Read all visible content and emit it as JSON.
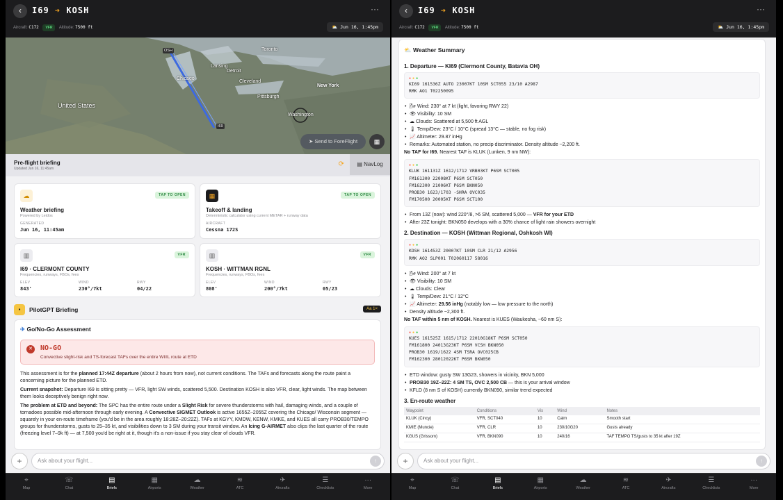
{
  "route": {
    "from": "I69",
    "to": "KOSH",
    "arrow": "➔"
  },
  "header": {
    "back_icon": "‹",
    "more_icon": "···",
    "aircraft_label": "Aircraft:",
    "aircraft": "C172",
    "rules_badge": "VFR",
    "altitude_label": "Altitude:",
    "altitude": "7500 ft",
    "time_icon": "⛅",
    "departure_time": "Jun 16, 1:45pm"
  },
  "map": {
    "labels": [
      "Toronto",
      "Lansing",
      "Detroit",
      "Chicago",
      "Cleveland",
      "New York",
      "United States",
      "Pittsburgh",
      "Washington",
      "I69",
      "OSH"
    ],
    "send_button": "Send to ForeFlight",
    "send_icon": "➤",
    "toggle_icon": "▦"
  },
  "preflight": {
    "title": "Pre-flight briefing",
    "updated": "Updated Jun 16, 11:45am",
    "refresh_icon": "⟳",
    "navlog_icon": "▤",
    "navlog_label": "NavLog"
  },
  "cards": {
    "tap_label": "TAP TO OPEN",
    "weather": {
      "title": "Weather briefing",
      "subtitle": "Powered by Leidos",
      "meta_label": "GENERATED",
      "meta_value": "Jun 16, 11:45am"
    },
    "takeoff": {
      "title": "Takeoff & landing",
      "subtitle": "Deterministic calculator using current METAR + runway data",
      "meta_label": "AIRCRAFT",
      "meta_value": "Cessna 172S"
    },
    "airport_labels": {
      "elev": "ELEV",
      "wind": "WIND",
      "rwy": "RWY"
    },
    "dep": {
      "title": "I69 · CLERMONT COUNTY",
      "subtitle": "Frequencies, runways, FBOs, fees",
      "badge": "VFR",
      "elev": "843'",
      "wind": "230°/7kt",
      "rwy": "04/22"
    },
    "arr": {
      "title": "KOSH · WITTMAN RGNL",
      "subtitle": "Frequencies, runways, FBOs, fees",
      "badge": "VFR",
      "elev": "808'",
      "wind": "200°/7kt",
      "rwy": "05/23"
    }
  },
  "pilotgpt": {
    "title": "PilotGPT Briefing",
    "font_chip": "Aa 1×"
  },
  "assessment": {
    "icon": "✈",
    "title": "Go/No-Go Assessment",
    "verdict_icon": "✕",
    "verdict": "NO-GO",
    "verdict_sub": "Convective slight-risk and TS-forecast TAFs over the entire WI/IL route at ETD",
    "p1a": "This assessment is for the ",
    "p1b": "planned 17:44Z departure",
    "p1c": " (about 2 hours from now), not current conditions. The TAFs and forecasts along the route paint a concerning picture for the planned ETD.",
    "p2a": "Current snapshot:",
    "p2b": " Departure I69 is sitting pretty — VFR, light SW winds, scattered 5,500. Destination KOSH is also VFR, clear, light winds. The map between them looks deceptively benign right now.",
    "p3a": "The problem at ETD and beyond:",
    "p3b": " The SPC has the entire route under a ",
    "p3c": "Slight Risk",
    "p3d": " for severe thunderstorms with hail, damaging winds, and a couple of tornadoes possible mid-afternoon through early evening. A ",
    "p3e": "Convective SIGMET Outlook",
    "p3f": " is active 1655Z–2055Z covering the Chicago/ Wisconsin segment — squarely in your en-route timeframe (you'd be in the area roughly 18:28Z–20:22Z). TAFs at KGYY, KMDW, KENW, KMKE, and KUES all carry PROB30/TEMPO groups for thunderstorms, gusts to 25–35 kt, and visibilities down to 3 SM during your transit window. An ",
    "p3g": "Icing G-AIRMET",
    "p3h": " also clips the last quarter of the route (freezing level 7–9k ft) — at 7,500 you'd be right at it, though it's a non-issue if you stay clear of clouds VFR."
  },
  "chat": {
    "plus_icon": "+",
    "placeholder": "Ask about your flight...",
    "send_icon": "↑"
  },
  "tabs": [
    {
      "icon": "⌖",
      "label": "Map"
    },
    {
      "icon": "☏",
      "label": "Chat"
    },
    {
      "icon": "▤",
      "label": "Briefs"
    },
    {
      "icon": "▦",
      "label": "Airports"
    },
    {
      "icon": "☁",
      "label": "Weather"
    },
    {
      "icon": "≋",
      "label": "ATC"
    },
    {
      "icon": "✈",
      "label": "Aircrafts"
    },
    {
      "icon": "☰",
      "label": "Checklists"
    },
    {
      "icon": "···",
      "label": "More"
    }
  ],
  "active_tab": "Briefs",
  "weather": {
    "icon": "⛅",
    "title": "Weather Summary",
    "dep_heading": "1. Departure — KI69 (Clermont County, Batavia OH)",
    "dep_metar": "KI69 161536Z AUTO 23007KT 10SM SCT055 23/10 A2987\nRMK AO1 T02250095",
    "dep_items": [
      {
        "icon": "🌬",
        "text": "Wind: 230° at 7 kt (light, favoring RWY 22)"
      },
      {
        "icon": "👁",
        "text": "Visibility: 10 SM"
      },
      {
        "icon": "☁",
        "text": "Clouds: Scattered at 5,500 ft AGL"
      },
      {
        "icon": "🌡",
        "text": "Temp/Dew: 23°C / 10°C (spread 13°C — stable, no fog risk)"
      },
      {
        "icon": "📈",
        "text": "Altimeter: 29.87 inHg"
      },
      {
        "icon": "",
        "text": "Remarks: Automated station, no precip discriminator. Density altitude ~2,200 ft."
      }
    ],
    "dep_taf_note_b": "No TAF for I69.",
    "dep_taf_note": " Nearest TAF is KLUK (Lunken, 9 nm NW):",
    "dep_taf": "KLUK 161131Z 1612/1712 VRB03KT P6SM SCT005\nFM161300 22008KT P6SM SCT050\nFM162300 21006KT P6SM BKN050\nPROB30 1623/1703 -SHRA OVC035\nFM170500 20005KT P6SM SCT100",
    "dep_taf_i1a": "From 13Z (now): wind 220°/8, >6 SM, scattered 5,000 — ",
    "dep_taf_i1b": "VFR for your ETD",
    "dep_taf_i2": "After 23Z tonight: BKN050 develops with a 30% chance of light rain showers overnight",
    "arr_heading": "2. Destination — KOSH (Wittman Regional, Oshkosh WI)",
    "arr_metar": "KOSH 161453Z 20007KT 10SM CLR 21/12 A2956\nRMK AO2 SLP001 T02060117 58016",
    "arr_items": [
      {
        "icon": "🌬",
        "text": "Wind: 200° at 7 kt"
      },
      {
        "icon": "👁",
        "text": "Visibility: 10 SM"
      },
      {
        "icon": "☁",
        "text": "Clouds: Clear"
      },
      {
        "icon": "🌡",
        "text": "Temp/Dew: 21°C / 12°C"
      }
    ],
    "arr_alt_a": "Altimeter: ",
    "arr_alt_b": "29.56 inHg",
    "arr_alt_c": " (notably low — low pressure to the north)",
    "arr_density": "Density altitude ~2,300 ft.",
    "arr_taf_note_b": "No TAF within 5 nm of KOSH.",
    "arr_taf_note": " Nearest is KUES (Waukesha, ~60 nm S):",
    "arr_taf": "KUES 161525Z 1615/1712 22010G18KT P6SM SCT050\nFM161800 24013G23KT P6SM VCSH BKN050\nPROB30 1619/1622 4SM TSRA OVC025CB\nFM162300 28012022KT P6SM BKN050",
    "arr_i1": "ETD window: gusty SW 13G23, showers in vicinity, BKN 5,000",
    "arr_i2a": "PROB30 19Z–22Z: 4 SM TS, OVC 2,500 CB",
    "arr_i2b": " — this is your arrival window",
    "arr_i3": "KFLD (8 nm S of KOSH) currently BKN090, similar trend expected",
    "enroute_heading": "3. En-route weather",
    "table_headers": [
      "Waypoint",
      "Conditions",
      "Vis",
      "Wind",
      "Notes"
    ],
    "table_rows": [
      [
        "KLUK (Cincy)",
        "VFR, SCT040",
        "10",
        "Calm",
        "Smooth start"
      ],
      [
        "KMIE (Muncie)",
        "VFR, CLR",
        "10",
        "230/10G20",
        "Gusts already"
      ],
      [
        "KGUS (Grissom)",
        "VFR, BKN090",
        "10",
        "240/16",
        "TAF TEMPO TS/gusts to 35 kt after 19Z"
      ]
    ]
  },
  "colors": {
    "vfr": "#5bd47c",
    "nogo": "#c0392b",
    "accent": "#f5a623"
  }
}
